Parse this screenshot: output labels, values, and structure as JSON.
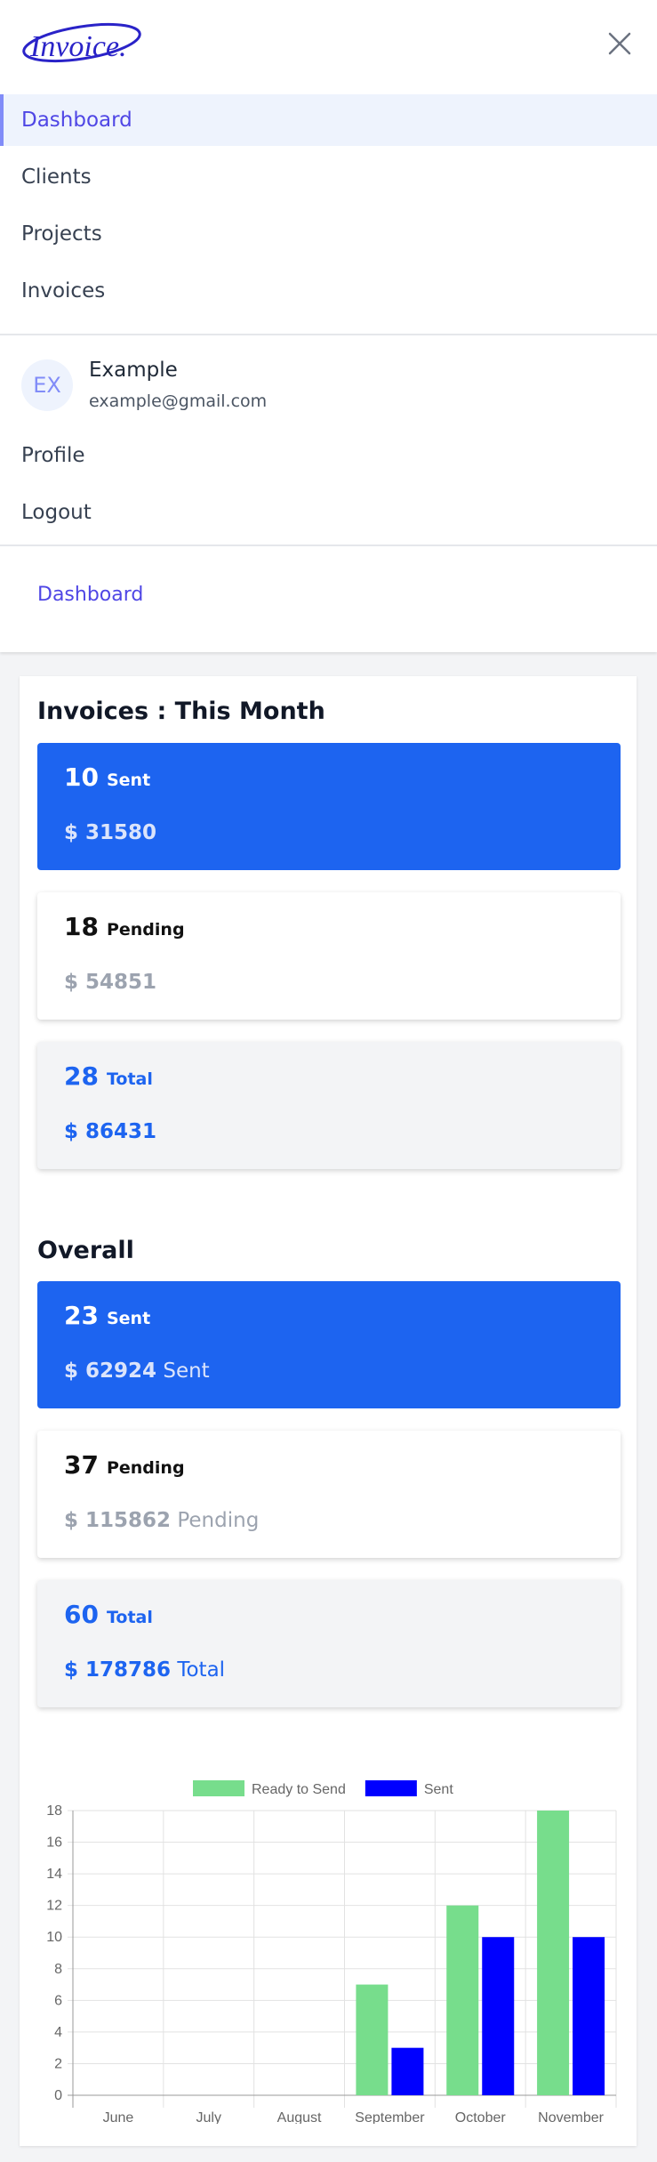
{
  "brand": {
    "logo_text": "Invoice."
  },
  "nav": {
    "items": [
      {
        "label": "Dashboard"
      },
      {
        "label": "Clients"
      },
      {
        "label": "Projects"
      },
      {
        "label": "Invoices"
      }
    ]
  },
  "user": {
    "initials": "EX",
    "name": "Example",
    "email": "example@gmail.com",
    "menu": [
      {
        "label": "Profile"
      },
      {
        "label": "Logout"
      }
    ]
  },
  "breadcrumb": {
    "current": "Dashboard"
  },
  "this_month": {
    "title": "Invoices : This Month",
    "sent": {
      "count": "10",
      "label": "Sent",
      "amount": "$ 31580"
    },
    "pending": {
      "count": "18",
      "label": "Pending",
      "amount": "$ 54851"
    },
    "total": {
      "count": "28",
      "label": "Total",
      "amount": "$ 86431"
    }
  },
  "overall": {
    "title": "Overall",
    "sent": {
      "count": "23",
      "label": "Sent",
      "amount": "$ 62924",
      "suffix": "Sent"
    },
    "pending": {
      "count": "37",
      "label": "Pending",
      "amount": "$ 115862",
      "suffix": "Pending"
    },
    "total": {
      "count": "60",
      "label": "Total",
      "amount": "$ 178786",
      "suffix": "Total"
    }
  },
  "colors": {
    "accent": "#4f46e5",
    "primary_blue": "#1d64f0",
    "ready_to_send": "#77dd8c",
    "sent_series": "#0000ff"
  },
  "chart_data": {
    "type": "bar",
    "categories": [
      "June",
      "July",
      "August",
      "September",
      "October",
      "November"
    ],
    "series": [
      {
        "name": "Ready to Send",
        "values": [
          0,
          0,
          0,
          7,
          12,
          18
        ],
        "color": "#77dd8c"
      },
      {
        "name": "Sent",
        "values": [
          0,
          0,
          0,
          3,
          10,
          10
        ],
        "color": "#0000ff"
      }
    ],
    "ylim": [
      0,
      18
    ],
    "yticks": [
      0,
      2,
      4,
      6,
      8,
      10,
      12,
      14,
      16,
      18
    ],
    "grid": true,
    "legend": "top"
  }
}
